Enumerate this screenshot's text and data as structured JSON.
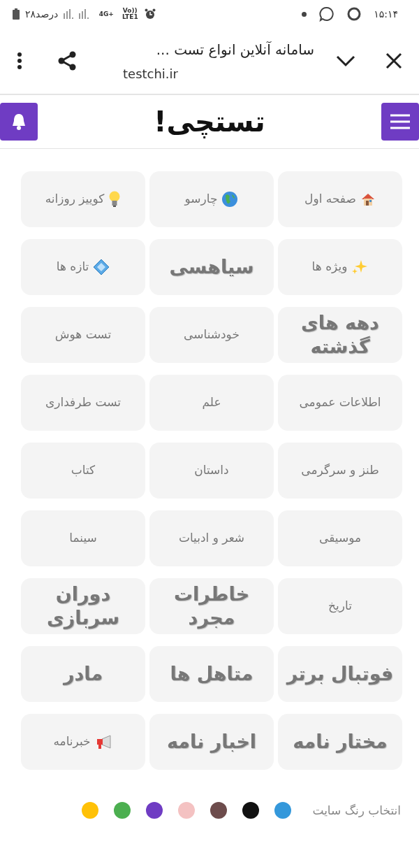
{
  "status_bar": {
    "time": "۱۵:۱۴",
    "battery": "۲۸درصد",
    "network": "4G+",
    "volte": "Vo)) LTE1"
  },
  "browser_bar": {
    "title": "سامانه آنلاین انواع تست ...",
    "url": "testchi.ir"
  },
  "header": {
    "logo": "تستچی!"
  },
  "tiles": [
    {
      "label": "صفحه اول",
      "kind": "house"
    },
    {
      "label": "چارسو",
      "kind": "globe"
    },
    {
      "label": "کوییز روزانه",
      "kind": "bulb"
    },
    {
      "label": "ویژه ها",
      "kind": "sparkles"
    },
    {
      "label": "سیاهسی",
      "kind": "large"
    },
    {
      "label": "تازه ها",
      "kind": "diamond"
    },
    {
      "label": "دهه های گذشته",
      "kind": "large"
    },
    {
      "label": "خودشناسی",
      "kind": "plain"
    },
    {
      "label": "تست هوش",
      "kind": "plain"
    },
    {
      "label": "اطلاعات عمومی",
      "kind": "plain"
    },
    {
      "label": "علم",
      "kind": "plain"
    },
    {
      "label": "تست طرفداری",
      "kind": "plain"
    },
    {
      "label": "طنز و سرگرمی",
      "kind": "plain"
    },
    {
      "label": "داستان",
      "kind": "plain"
    },
    {
      "label": "کتاب",
      "kind": "plain"
    },
    {
      "label": "موسیقی",
      "kind": "plain"
    },
    {
      "label": "شعر و ادبیات",
      "kind": "plain"
    },
    {
      "label": "سینما",
      "kind": "plain"
    },
    {
      "label": "تاریخ",
      "kind": "plain"
    },
    {
      "label": "خاطرات مجرد",
      "kind": "large"
    },
    {
      "label": "دوران سربازی",
      "kind": "large"
    },
    {
      "label": "فوتبال برتر",
      "kind": "large"
    },
    {
      "label": "متاهل ها",
      "kind": "large"
    },
    {
      "label": "مادر",
      "kind": "large"
    },
    {
      "label": "مختار نامه",
      "kind": "large"
    },
    {
      "label": "اخبار نامه",
      "kind": "large"
    },
    {
      "label": "خبرنامه",
      "kind": "megaphone"
    }
  ],
  "color_picker": {
    "label": "انتخاب رنگ سایت",
    "colors": [
      {
        "color": "#3498db"
      },
      {
        "color": "#111111"
      },
      {
        "color": "#6d4c4c"
      },
      {
        "color": "#f4c2c2"
      },
      {
        "color": "#6f3cc3"
      },
      {
        "color": "#4caf50"
      },
      {
        "color": "#ffc107"
      }
    ]
  }
}
